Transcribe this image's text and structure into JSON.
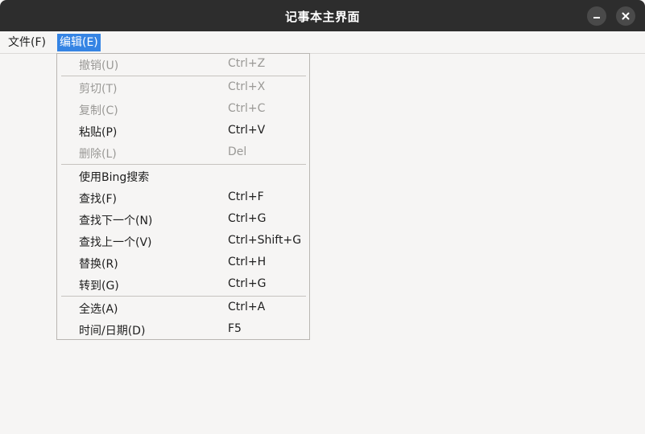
{
  "window": {
    "title": "记事本主界面"
  },
  "menubar": {
    "items": [
      {
        "label": "文件(F)"
      },
      {
        "label": "编辑(E)",
        "active": true
      }
    ]
  },
  "edit_menu": {
    "items": [
      {
        "label": "撤销(U)",
        "shortcut": "Ctrl+Z",
        "enabled": false
      },
      {
        "label": "剪切(T)",
        "shortcut": "Ctrl+X",
        "enabled": false
      },
      {
        "label": "复制(C)",
        "shortcut": "Ctrl+C",
        "enabled": false
      },
      {
        "label": "粘贴(P)",
        "shortcut": "Ctrl+V",
        "enabled": true
      },
      {
        "label": "删除(L)",
        "shortcut": "Del",
        "enabled": false
      },
      {
        "label": "使用Bing搜索",
        "shortcut": "",
        "enabled": true
      },
      {
        "label": "查找(F)",
        "shortcut": "Ctrl+F",
        "enabled": true
      },
      {
        "label": "查找下一个(N)",
        "shortcut": "Ctrl+G",
        "enabled": true
      },
      {
        "label": "查找上一个(V)",
        "shortcut": "Ctrl+Shift+G",
        "enabled": true
      },
      {
        "label": "替换(R)",
        "shortcut": "Ctrl+H",
        "enabled": true
      },
      {
        "label": "转到(G)",
        "shortcut": "Ctrl+G",
        "enabled": true
      },
      {
        "label": "全选(A)",
        "shortcut": "Ctrl+A",
        "enabled": true
      },
      {
        "label": "时间/日期(D)",
        "shortcut": "F5",
        "enabled": true
      }
    ]
  },
  "colors": {
    "titlebar": "#2d2d2d",
    "accent": "#3584e4",
    "disabled_text": "#9a9996"
  },
  "icons": {
    "minimize": "minimize-icon",
    "close": "close-icon"
  }
}
